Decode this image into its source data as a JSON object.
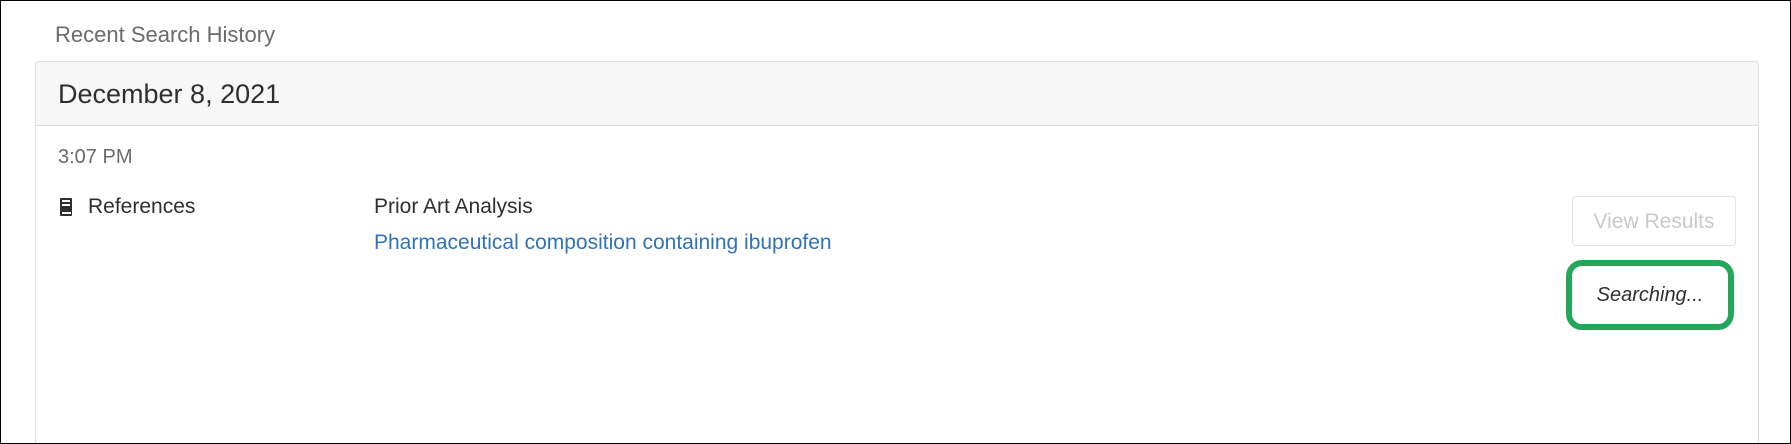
{
  "section": {
    "title": "Recent Search History"
  },
  "history": {
    "date": "December 8, 2021",
    "time": "3:07 PM",
    "type_icon": "book-icon",
    "type_label": "References",
    "analysis_title": "Prior Art Analysis",
    "query_text": "Pharmaceutical composition containing ibuprofen",
    "view_results_label": "View Results",
    "status_label": "Searching..."
  },
  "colors": {
    "link": "#2f73b8",
    "status_border": "#24a75a",
    "disabled_text": "#c9c9c9",
    "header_background": "#f7f7f7"
  }
}
